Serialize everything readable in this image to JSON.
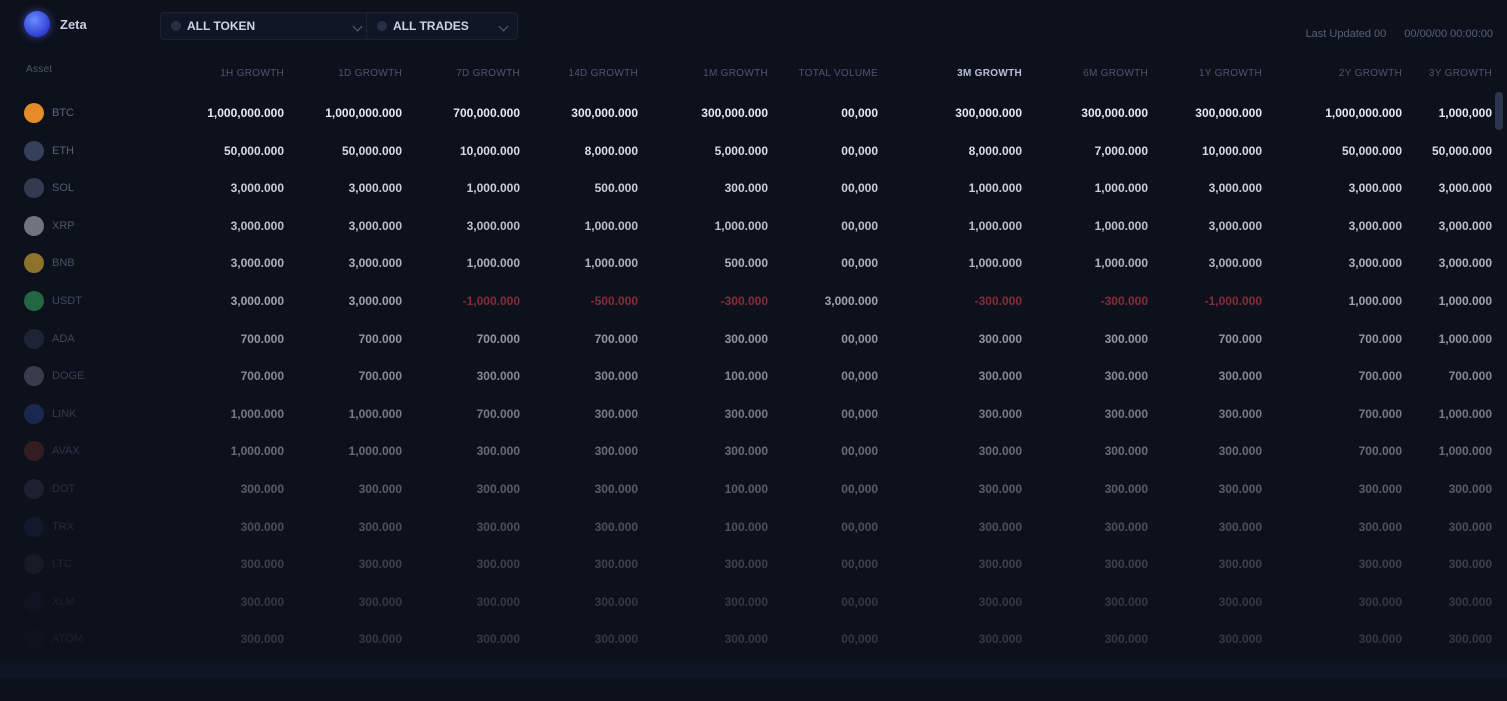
{
  "brand": {
    "name": "Zeta"
  },
  "selectors": [
    {
      "label": "ALL TOKEN"
    },
    {
      "label": "ALL TRADES"
    }
  ],
  "top_right": [
    "Last Updated 00",
    "00/00/00 00:00:00"
  ],
  "header": {
    "asset": "Asset",
    "columns": [
      "1H GROWTH",
      "1D GROWTH",
      "7D GROWTH",
      "14D GROWTH",
      "1M GROWTH",
      "TOTAL VOLUME",
      "3M GROWTH",
      "6M GROWTH",
      "1Y GROWTH",
      "2Y GROWTH",
      "3Y GROWTH"
    ],
    "active_index": 6
  },
  "rows": [
    {
      "symbol": "BTC",
      "coin_color": "#e48b2a",
      "values": [
        "1,000,000.000",
        "1,000,000.000",
        "700,000.000",
        "300,000.000",
        "300,000.000",
        "00,000",
        "300,000.000",
        "300,000.000",
        "300,000.000",
        "1,000,000.000",
        "1,000,000"
      ]
    },
    {
      "symbol": "ETH",
      "coin_color": "#3b4460",
      "values": [
        "50,000.000",
        "50,000.000",
        "10,000.000",
        "8,000.000",
        "5,000.000",
        "00,000",
        "8,000.000",
        "7,000.000",
        "10,000.000",
        "50,000.000",
        "50,000.000"
      ]
    },
    {
      "symbol": "SOL",
      "coin_color": "#3a4158",
      "values": [
        "3,000.000",
        "3,000.000",
        "1,000.000",
        "500.000",
        "300.000",
        "00,000",
        "1,000.000",
        "1,000.000",
        "3,000.000",
        "3,000.000",
        "3,000.000"
      ]
    },
    {
      "symbol": "XRP",
      "coin_color": "#8a8d98",
      "values": [
        "3,000.000",
        "3,000.000",
        "3,000.000",
        "1,000.000",
        "1,000.000",
        "00,000",
        "1,000.000",
        "1,000.000",
        "3,000.000",
        "3,000.000",
        "3,000.000"
      ]
    },
    {
      "symbol": "BNB",
      "coin_color": "#b9942f",
      "values": [
        "3,000.000",
        "3,000.000",
        "1,000.000",
        "1,000.000",
        "500.000",
        "00,000",
        "1,000.000",
        "1,000.000",
        "3,000.000",
        "3,000.000",
        "3,000.000"
      ]
    },
    {
      "symbol": "USDT",
      "coin_color": "#2f8f55",
      "values": [
        "3,000.000",
        "3,000.000",
        "-1,000.000",
        "-500.000",
        "-300.000",
        "3,000.000",
        "-300.000",
        "-300.000",
        "-1,000.000",
        "1,000.000",
        "1,000.000"
      ],
      "negative": [
        2,
        3,
        4,
        6,
        7,
        8
      ]
    },
    {
      "symbol": "ADA",
      "coin_color": "#2a3045",
      "values": [
        "700.000",
        "700.000",
        "700.000",
        "700.000",
        "300.000",
        "00,000",
        "300.000",
        "300.000",
        "700.000",
        "700.000",
        "1,000.000"
      ]
    },
    {
      "symbol": "DOGE",
      "coin_color": "#5f6373",
      "values": [
        "700.000",
        "700.000",
        "300.000",
        "300.000",
        "100.000",
        "00,000",
        "300.000",
        "300.000",
        "300.000",
        "700.000",
        "700.000"
      ]
    },
    {
      "symbol": "LINK",
      "coin_color": "#2a3f87",
      "values": [
        "1,000.000",
        "1,000.000",
        "700.000",
        "300.000",
        "300.000",
        "00,000",
        "300.000",
        "300.000",
        "300.000",
        "700.000",
        "1,000.000"
      ]
    },
    {
      "symbol": "AVAX",
      "coin_color": "#6a2f2a",
      "values": [
        "1,000.000",
        "1,000.000",
        "300.000",
        "300.000",
        "300.000",
        "00,000",
        "300.000",
        "300.000",
        "300.000",
        "700.000",
        "1,000.000"
      ]
    },
    {
      "symbol": "DOT",
      "coin_color": "#3a3f4f",
      "values": [
        "300.000",
        "300.000",
        "300.000",
        "300.000",
        "100.000",
        "00,000",
        "300.000",
        "300.000",
        "300.000",
        "300.000",
        "300.000"
      ]
    },
    {
      "symbol": "TRX",
      "coin_color": "#232d55",
      "values": [
        "300.000",
        "300.000",
        "300.000",
        "300.000",
        "100.000",
        "00,000",
        "300.000",
        "300.000",
        "300.000",
        "300.000",
        "300.000"
      ]
    },
    {
      "symbol": "LTC",
      "coin_color": "#3c4052",
      "values": [
        "300.000",
        "300.000",
        "300.000",
        "300.000",
        "300.000",
        "00,000",
        "300.000",
        "300.000",
        "300.000",
        "300.000",
        "300.000"
      ]
    },
    {
      "symbol": "XLM",
      "coin_color": "#1c2234",
      "values": [
        "300.000",
        "300.000",
        "300.000",
        "300.000",
        "300.000",
        "00,000",
        "300.000",
        "300.000",
        "300.000",
        "300.000",
        "300.000"
      ]
    },
    {
      "symbol": "ATOM",
      "coin_color": "#171c2b",
      "values": [
        "300.000",
        "300.000",
        "300.000",
        "300.000",
        "300.000",
        "00,000",
        "300.000",
        "300.000",
        "300.000",
        "300.000",
        "300.000"
      ]
    }
  ]
}
